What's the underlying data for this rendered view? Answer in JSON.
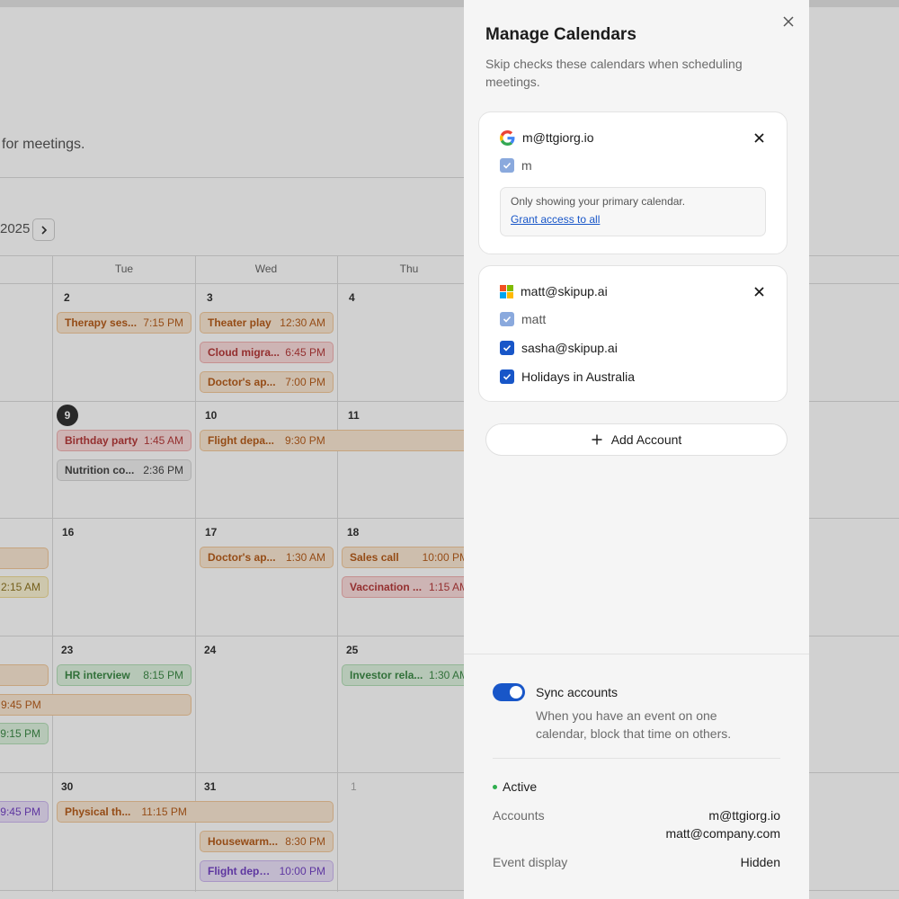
{
  "background": {
    "subtitle": "for meetings.",
    "year": "2025",
    "weekdays": [
      "Tue",
      "Wed",
      "Thu"
    ],
    "days": [
      {
        "num": "2"
      },
      {
        "num": "3"
      },
      {
        "num": "4"
      },
      {
        "num": "9"
      },
      {
        "num": "10"
      },
      {
        "num": "11"
      },
      {
        "num": "16"
      },
      {
        "num": "17"
      },
      {
        "num": "18"
      },
      {
        "num": "23"
      },
      {
        "num": "24"
      },
      {
        "num": "25"
      },
      {
        "num": "30"
      },
      {
        "num": "31"
      },
      {
        "num": "1"
      }
    ],
    "events": [
      {
        "title": "Therapy ses...",
        "time": "7:15 PM"
      },
      {
        "title": "Theater play",
        "time": "12:30 AM"
      },
      {
        "title": "Cloud migra...",
        "time": "6:45 PM"
      },
      {
        "title": "Doctor's ap...",
        "time": "7:00 PM"
      },
      {
        "title": "Birthday party",
        "time": "1:45 AM"
      },
      {
        "title": "Nutrition co...",
        "time": "2:36 PM"
      },
      {
        "title": "Flight depa...",
        "time": "9:30 PM"
      },
      {
        "title": "",
        "time": ""
      },
      {
        "title": "",
        "time": "2:15 AM"
      },
      {
        "title": "Doctor's ap...",
        "time": "1:30 AM"
      },
      {
        "title": "Sales call",
        "time": "10:00 PM"
      },
      {
        "title": "Vaccination ...",
        "time": "1:15 AM"
      },
      {
        "title": "",
        "time": ""
      },
      {
        "title": "HR interview",
        "time": "8:15 PM"
      },
      {
        "title": "Investor rela...",
        "time": "1:30 AM"
      },
      {
        "title": "",
        "time": "9:45 PM"
      },
      {
        "title": "",
        "time": "9:15 PM"
      },
      {
        "title": "",
        "time": "9:45 PM"
      },
      {
        "title": "Physical th...",
        "time": "11:15 PM"
      },
      {
        "title": "Housewarm...",
        "time": "8:30 PM"
      },
      {
        "title": "Flight depa...",
        "time": "10:00 PM"
      }
    ]
  },
  "panel": {
    "title": "Manage Calendars",
    "description": "Skip checks these calendars when scheduling meetings.",
    "accounts": [
      {
        "email": "m@ttgiorg.io",
        "provider_icon": "google-icon",
        "calendars": [
          {
            "label": "m",
            "checked": true,
            "locked": true
          }
        ],
        "note": "Only showing your primary calendar.",
        "note_link": "Grant access to all"
      },
      {
        "email": "matt@skipup.ai",
        "provider_icon": "microsoft-icon",
        "calendars": [
          {
            "label": "matt",
            "checked": true,
            "locked": true
          },
          {
            "label": "sasha@skipup.ai",
            "checked": true,
            "locked": false
          },
          {
            "label": "Holidays in Australia",
            "checked": true,
            "locked": false
          }
        ]
      }
    ],
    "add_account_label": "Add Account",
    "sync": {
      "title": "Sync accounts",
      "enabled": true,
      "description": "When you have an event on one calendar, block that time on others.",
      "status": "Active",
      "accounts_label": "Accounts",
      "accounts_values": [
        "m@ttgiorg.io",
        "matt@company.com"
      ],
      "event_display_label": "Event display",
      "event_display_value": "Hidden"
    },
    "colors": {
      "accent": "#1856c8",
      "checkbox_locked": "#8aa9dd",
      "active_dot": "#2fae4e"
    }
  }
}
